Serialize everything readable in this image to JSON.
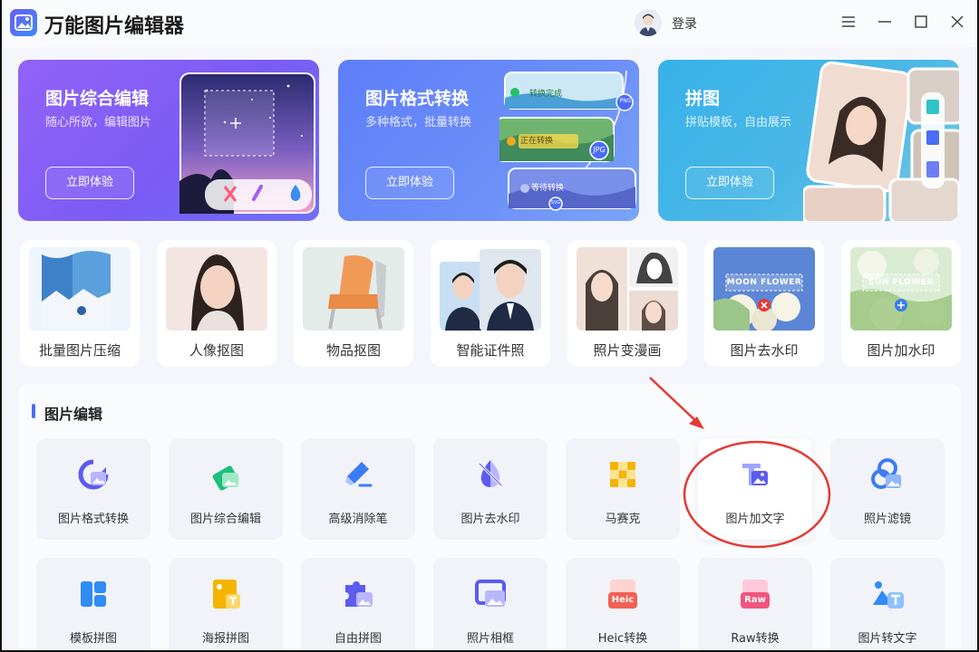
{
  "app": {
    "title": "万能图片编辑器",
    "login_label": "登录"
  },
  "window_controls": [
    "menu-icon",
    "minimize-icon",
    "maximize-icon",
    "close-icon"
  ],
  "banners": [
    {
      "title": "图片综合编辑",
      "subtitle": "随心所欲，编辑图片",
      "button": "立即体验"
    },
    {
      "title": "图片格式转换",
      "subtitle": "多种格式，批量转换",
      "button": "立即体验",
      "chips": [
        "转换完成",
        "正在转换",
        "等待转换"
      ],
      "formats": [
        "PNG",
        "JPG",
        "SVG"
      ]
    },
    {
      "title": "拼图",
      "subtitle": "拼贴模板，自由展示",
      "button": "立即体验"
    }
  ],
  "quick_tools": [
    {
      "label": "批量图片压缩"
    },
    {
      "label": "人像抠图"
    },
    {
      "label": "物品抠图"
    },
    {
      "label": "智能证件照"
    },
    {
      "label": "照片变漫画"
    },
    {
      "label": "图片去水印",
      "sample_text": "MOON FLOWER"
    },
    {
      "label": "图片加水印",
      "sample_text": "SUN FLOWER"
    }
  ],
  "section": {
    "title": "图片编辑",
    "tools": [
      {
        "label": "图片格式转换",
        "icon": "format-convert-icon"
      },
      {
        "label": "图片综合编辑",
        "icon": "image-edit-icon"
      },
      {
        "label": "高级消除笔",
        "icon": "eraser-pen-icon"
      },
      {
        "label": "图片去水印",
        "icon": "remove-watermark-icon"
      },
      {
        "label": "马赛克",
        "icon": "mosaic-icon"
      },
      {
        "label": "图片加文字",
        "icon": "add-text-icon",
        "highlighted": true
      },
      {
        "label": "照片滤镜",
        "icon": "filter-icon"
      },
      {
        "label": "模板拼图",
        "icon": "template-collage-icon"
      },
      {
        "label": "海报拼图",
        "icon": "poster-collage-icon"
      },
      {
        "label": "自由拼图",
        "icon": "free-collage-icon"
      },
      {
        "label": "照片相框",
        "icon": "photo-frame-icon"
      },
      {
        "label": "Heic转换",
        "icon": "heic-icon",
        "badge": "Heic"
      },
      {
        "label": "Raw转换",
        "icon": "raw-icon",
        "badge": "Raw"
      },
      {
        "label": "图片转文字",
        "icon": "image-to-text-icon"
      }
    ]
  },
  "colors": {
    "accent": "#4b6cf6",
    "annotation": "#e53935"
  }
}
